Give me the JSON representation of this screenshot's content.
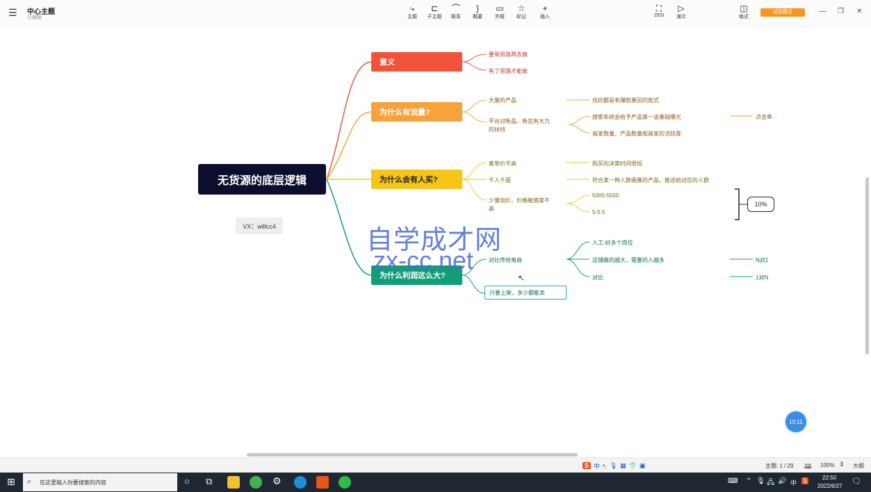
{
  "app": {
    "title": "中心主题",
    "subtitle": "已编辑",
    "trial_label": "试用模式"
  },
  "toolbar": [
    {
      "label": "主题",
      "icon": "⤷"
    },
    {
      "label": "子主题",
      "icon": "⊏"
    },
    {
      "label": "联系",
      "icon": "⌒"
    },
    {
      "label": "概要",
      "icon": "}"
    },
    {
      "label": "外框",
      "icon": "▭"
    },
    {
      "label": "标记",
      "icon": "☆"
    },
    {
      "label": "插入",
      "icon": "+"
    }
  ],
  "toolbar_right": [
    {
      "label": "ZEN",
      "icon": "⛶"
    },
    {
      "label": "演示",
      "icon": "▷"
    },
    {
      "label": "格式",
      "icon": "◫"
    }
  ],
  "mindmap": {
    "root": "无货源的底层逻辑",
    "note": "VX：willcc4",
    "branches": [
      {
        "title": "意义",
        "color": "#f0533a",
        "items": [
          "要有思路再去做",
          "有了思路才能做"
        ]
      },
      {
        "title": "为什么有流量?",
        "color": "#f7a23a",
        "items": [
          "大量的产品",
          "平台对新品、新店有大力",
          "的扶持"
        ],
        "details": [
          "找的都是有爆款基因的款式",
          "搜索系统会给予产品第一波基础曝光",
          "商家数量、产品数量和商家的活跃度",
          "点击率"
        ]
      },
      {
        "title": "为什么会有人买?",
        "color": "#f5c518",
        "items": [
          "客单价不高",
          "千人千面",
          "少量加价，价格敏感度不",
          "高"
        ],
        "details": [
          "购买的决策时间很短",
          "符合某一种人群画像的产品，推送给对应的人群",
          "5000-5500",
          "5-5.5",
          "10%"
        ]
      },
      {
        "title": "为什么利润这么大?",
        "color": "#0f9e76",
        "items": [
          "对比传统电商",
          "只要上架，多少都能卖"
        ],
        "details": [
          "人工-好多个岗位",
          "店铺做的越大，需要的人越多",
          "对比",
          "N对1",
          "1对N"
        ]
      }
    ]
  },
  "watermark": {
    "line1": "自学成才网",
    "line2": "zx-cc.net"
  },
  "timer": "15:11",
  "status": {
    "topics": "主题: 1 / 29",
    "zoom": "100%",
    "size_label": "大纲"
  },
  "taskbar": {
    "search_placeholder": "在这里输入你要搜索的内容",
    "ime": "中",
    "time": "22:50",
    "date": "2022/6/27"
  }
}
